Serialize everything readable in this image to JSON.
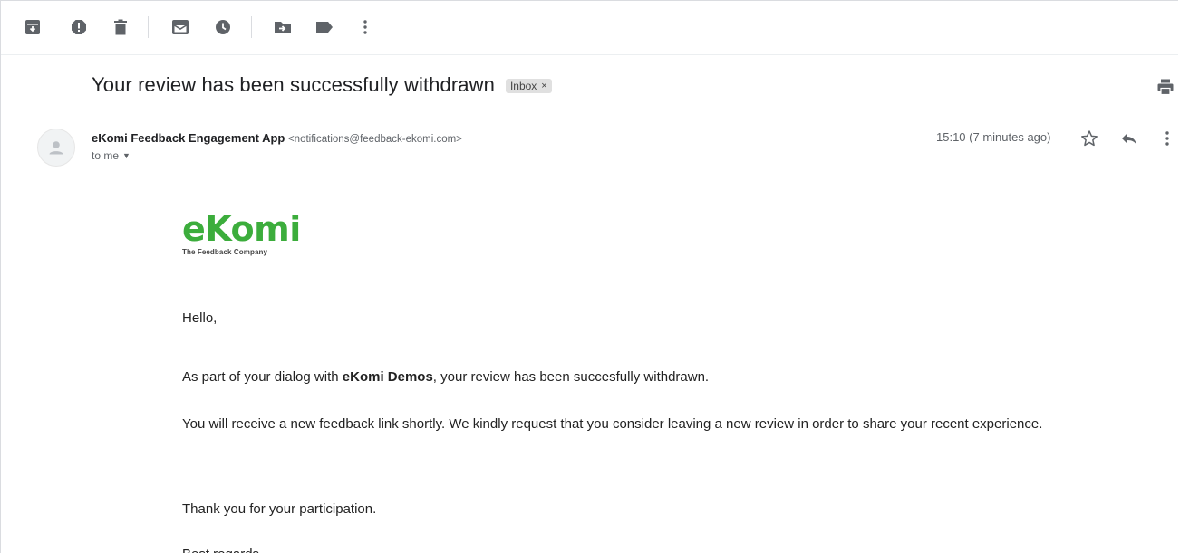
{
  "toolbar": {
    "icons": [
      "archive-icon",
      "report-spam-icon",
      "delete-icon",
      "mark-unread-icon",
      "snooze-icon",
      "move-to-icon",
      "label-icon",
      "more-vert-icon"
    ]
  },
  "email": {
    "subject": "Your review has been successfully withdrawn",
    "label": "Inbox",
    "label_close": "×",
    "sender_name": "eKomi Feedback Engagement App",
    "sender_email": "<notifications@feedback-ekomi.com>",
    "recipient": "to me",
    "time": "15:10 (7 minutes ago)"
  },
  "logo": {
    "name": "eKomi",
    "tagline": "The Feedback Company"
  },
  "body": {
    "greeting": "Hello,",
    "p1_before": "As part of your dialog with ",
    "p1_bold": "eKomi Demos",
    "p1_after": ", your review has been succesfully withdrawn.",
    "p2": "You will receive a new feedback link shortly. We kindly request that you consider leaving a new review in order to share your recent experience.",
    "p3": "Thank you for your participation.",
    "p4": "Best regards,"
  },
  "colors": {
    "brand_green": "#3cad3c",
    "icon_gray": "#5f6368"
  }
}
